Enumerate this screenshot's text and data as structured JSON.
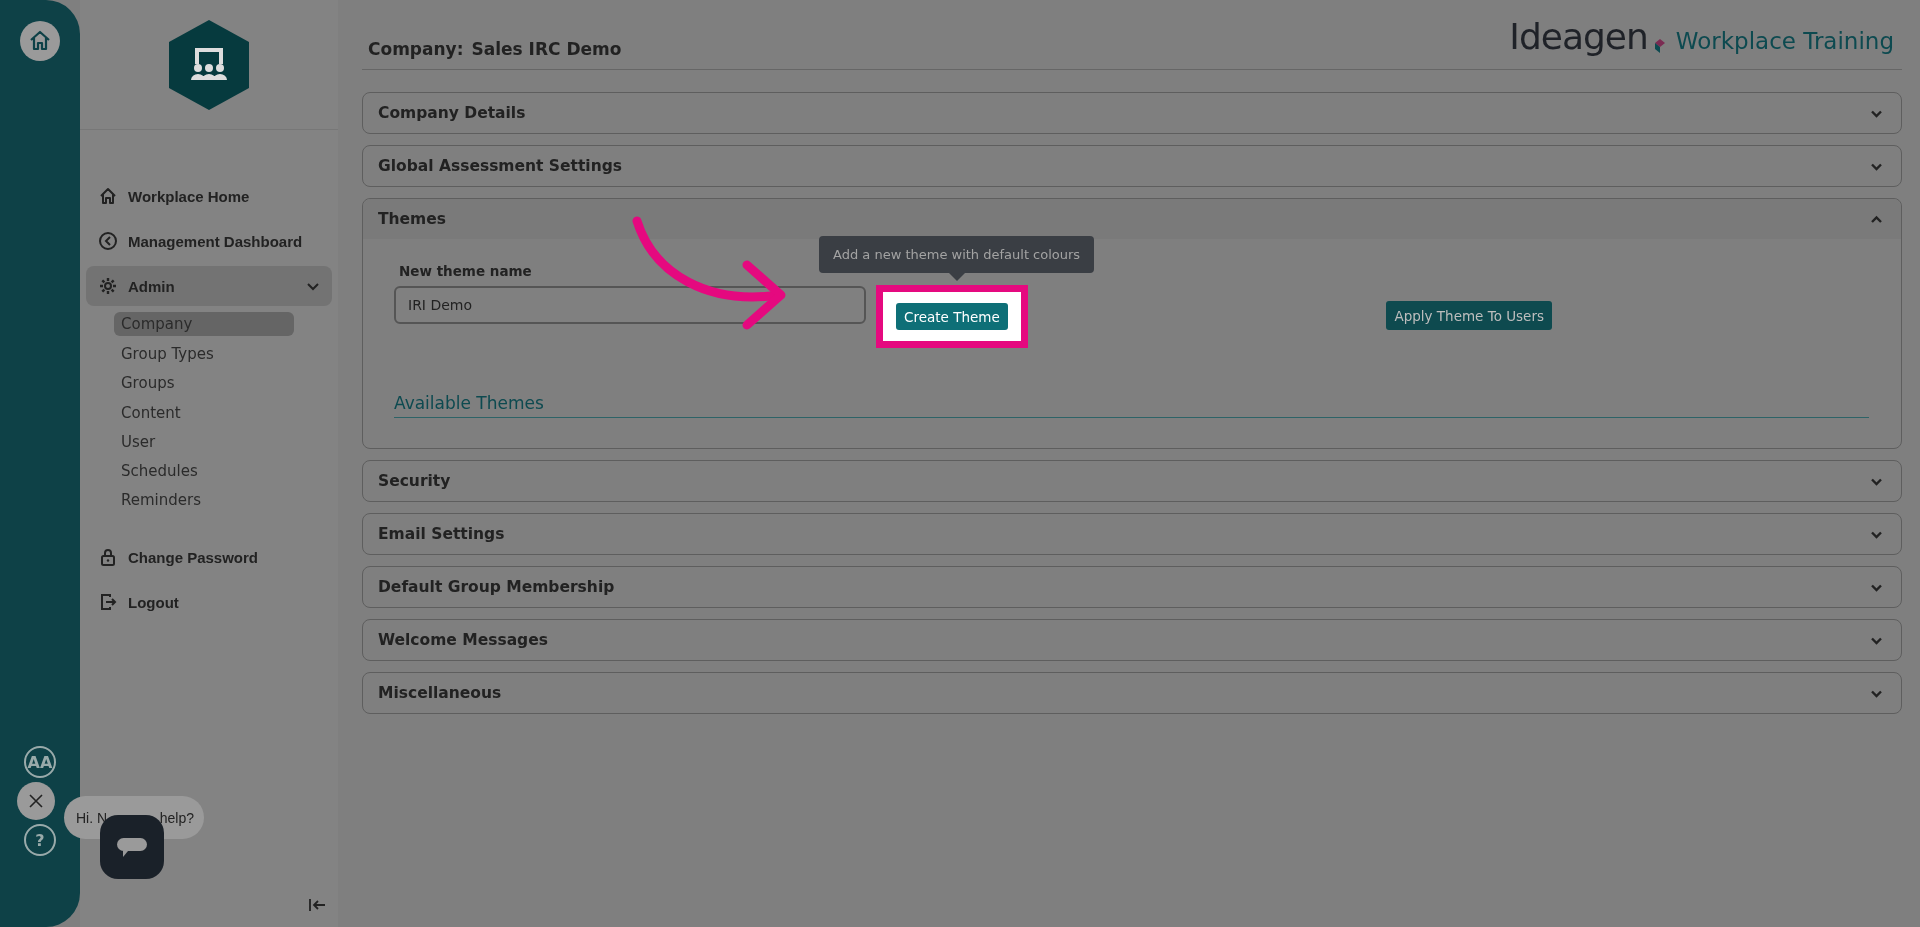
{
  "rail": {
    "text_size_button": "AA",
    "help_button": "?"
  },
  "sidebar": {
    "items": [
      {
        "label": "Workplace Home",
        "selected": false
      },
      {
        "label": "Management Dashboard",
        "selected": false
      },
      {
        "label": "Admin",
        "expanded": true,
        "children": [
          {
            "label": "Company",
            "selected": true
          },
          {
            "label": "Group Types",
            "selected": false
          },
          {
            "label": "Groups",
            "selected": false
          },
          {
            "label": "Content",
            "selected": false
          },
          {
            "label": "User",
            "selected": false
          },
          {
            "label": "Schedules",
            "selected": false
          },
          {
            "label": "Reminders",
            "selected": false
          }
        ]
      },
      {
        "label": "Change Password",
        "selected": false
      },
      {
        "label": "Logout",
        "selected": false
      }
    ]
  },
  "chat": {
    "greeting_start": "Hi. N",
    "greeting_end": "help?"
  },
  "header": {
    "company_label": "Company:",
    "company_name": "Sales IRC Demo",
    "brand": "Ideagen",
    "product": "Workplace Training"
  },
  "sections": [
    {
      "title": "Company Details",
      "expanded": false
    },
    {
      "title": "Global Assessment Settings",
      "expanded": false
    },
    {
      "title": "Themes",
      "expanded": true,
      "content": {
        "field_label": "New theme name",
        "field_value": "IRI Demo",
        "create_button": "Create Theme",
        "tooltip": "Add a new theme with default colours",
        "apply_button": "Apply Theme To Users",
        "available_heading": "Available Themes"
      }
    },
    {
      "title": "Security",
      "expanded": false
    },
    {
      "title": "Email Settings",
      "expanded": false
    },
    {
      "title": "Default Group Membership",
      "expanded": false
    },
    {
      "title": "Welcome Messages",
      "expanded": false
    },
    {
      "title": "Miscellaneous",
      "expanded": false
    }
  ]
}
